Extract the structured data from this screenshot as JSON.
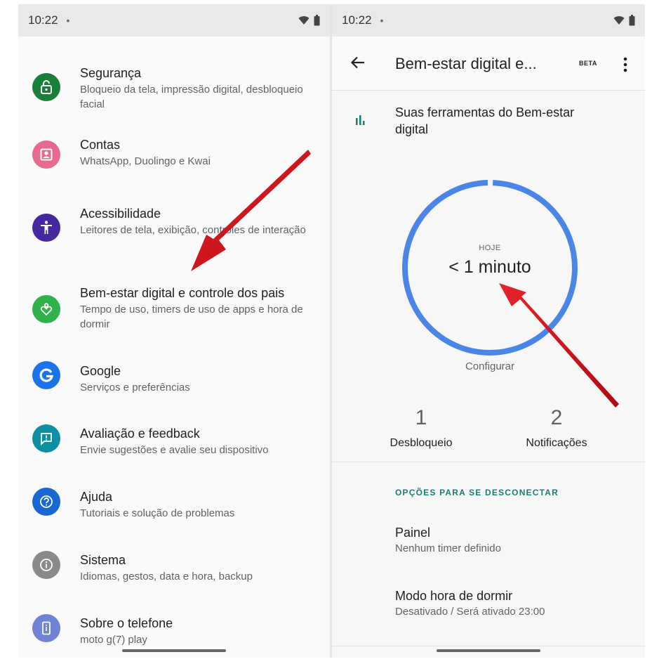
{
  "left_screen": {
    "status_bar": {
      "time": "10:22",
      "dot": "•"
    },
    "items": [
      {
        "title": "Segurança",
        "subtitle": "Bloqueio da tela, impressão digital, desbloqueio facial",
        "icon": "lock-open-icon",
        "color": "#188038"
      },
      {
        "title": "Contas",
        "subtitle": "WhatsApp, Duolingo e Kwai",
        "icon": "account-box-icon",
        "color": "#e8688f"
      },
      {
        "title": "Acessibilidade",
        "subtitle": "Leitores de tela, exibição, controles de interação",
        "icon": "accessibility-icon",
        "color": "#4527a0"
      },
      {
        "title": "Bem-estar digital e controle dos pais",
        "subtitle": "Tempo de uso, timers de uso de apps e hora de dormir",
        "icon": "wellbeing-heart-icon",
        "color": "#2fb24a"
      },
      {
        "title": "Google",
        "subtitle": "Serviços e preferências",
        "icon": "google-g-icon",
        "color": "#1a73e8"
      },
      {
        "title": "Avaliação e feedback",
        "subtitle": "Envie sugestões e avalie seu dispositivo",
        "icon": "feedback-icon",
        "color": "#0b8fa3"
      },
      {
        "title": "Ajuda",
        "subtitle": "Tutoriais e solução de problemas",
        "icon": "help-icon",
        "color": "#1967d2"
      },
      {
        "title": "Sistema",
        "subtitle": "Idiomas, gestos, data e hora, backup",
        "icon": "info-icon",
        "color": "#8a8a8a"
      },
      {
        "title": "Sobre o telefone",
        "subtitle": "moto g(7) play",
        "icon": "phone-info-icon",
        "color": "#6f83d6"
      }
    ]
  },
  "right_screen": {
    "status_bar": {
      "time": "10:22",
      "dot": "•"
    },
    "app_bar": {
      "title": "Bem-estar digital e...",
      "badge": "BETA"
    },
    "tools_label": "Suas ferramentas do Bem-estar digital",
    "ring": {
      "label": "HOJE",
      "value": "< 1 minuto",
      "fill_fraction": 0.99
    },
    "configure": "Configurar",
    "stats": [
      {
        "value": "1",
        "label": "Desbloqueio"
      },
      {
        "value": "2",
        "label": "Notificações"
      }
    ],
    "section_header": "OPÇÕES PARA SE DESCONECTAR",
    "options": [
      {
        "title": "Painel",
        "subtitle": "Nenhum timer definido"
      },
      {
        "title": "Modo hora de dormir",
        "subtitle": "Desativado / Será ativado 23:00"
      }
    ]
  },
  "colors": {
    "ring": "#4a86e8",
    "annotation_arrow": "#d0101a",
    "section_header": "#167e77"
  }
}
